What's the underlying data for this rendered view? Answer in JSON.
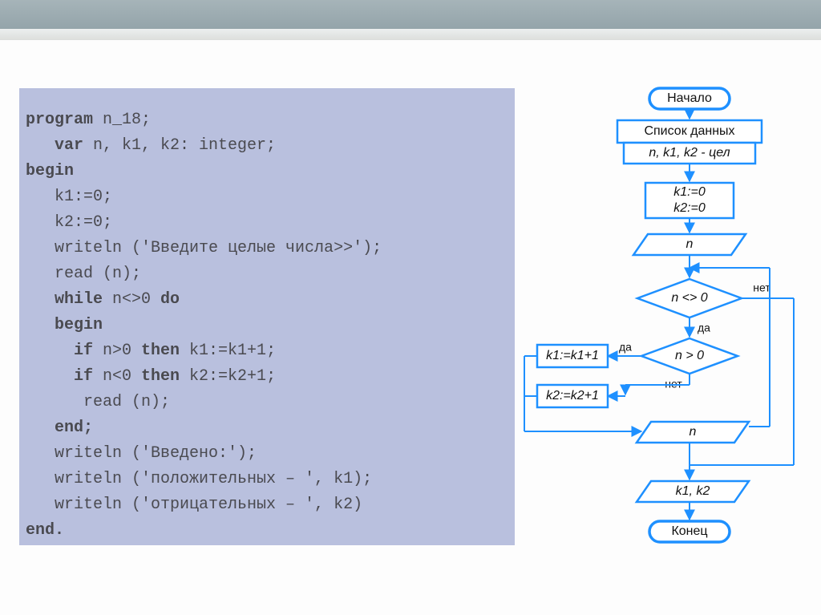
{
  "code": {
    "l01a": "program",
    "l01b": " n_18;",
    "l02a": "   var",
    "l02b": " n, k1, k2: integer;",
    "l03a": "begin",
    "l04": "   k1:=0;",
    "l05": "   k2:=0;",
    "l06": "   writeln ('Введите целые числа>>');",
    "l07": "   read (n);",
    "l08a": "   while ",
    "l08b": "n<>0 ",
    "l08c": "do",
    "l09a": "   begin",
    "l10a": "     if ",
    "l10b": "n>0 ",
    "l10c": "then ",
    "l10d": "k1:=k1+1;",
    "l11a": "     if ",
    "l11b": "n<0 ",
    "l11c": "then ",
    "l11d": "k2:=k2+1;",
    "l12": "      read (n);",
    "l13a": "   end;",
    "l14": "   writeln ('Введено:');",
    "l15": "   writeln ('положительных – ', k1);",
    "l16": "   writeln ('отрицательных – ', k2)",
    "l17a": "end."
  },
  "flow": {
    "start": "Начало",
    "datalist": "Список данных",
    "vars": "n, k1, k2 - цел",
    "init1": "k1:=0",
    "init2": "k2:=0",
    "in_n1": "n",
    "cond1": "n <> 0",
    "cond2": "n > 0",
    "assign1": "k1:=k1+1",
    "assign2": "k2:=k2+1",
    "in_n2": "n",
    "out": "k1, k2",
    "end": "Конец",
    "yes": "да",
    "no": "нет"
  },
  "chart_data": {
    "type": "flowchart",
    "nodes": [
      {
        "id": "start",
        "kind": "terminator",
        "text": "Начало"
      },
      {
        "id": "datalist",
        "kind": "process",
        "text": "Список данных"
      },
      {
        "id": "vars",
        "kind": "process",
        "text": "n, k1, k2 - цел"
      },
      {
        "id": "init",
        "kind": "process",
        "text": "k1:=0; k2:=0"
      },
      {
        "id": "in_n1",
        "kind": "io",
        "text": "n"
      },
      {
        "id": "cond1",
        "kind": "decision",
        "text": "n <> 0"
      },
      {
        "id": "cond2",
        "kind": "decision",
        "text": "n > 0"
      },
      {
        "id": "assign1",
        "kind": "process",
        "text": "k1:=k1+1"
      },
      {
        "id": "assign2",
        "kind": "process",
        "text": "k2:=k2+1"
      },
      {
        "id": "in_n2",
        "kind": "io",
        "text": "n"
      },
      {
        "id": "out",
        "kind": "io",
        "text": "k1, k2"
      },
      {
        "id": "end",
        "kind": "terminator",
        "text": "Конец"
      }
    ],
    "edges": [
      {
        "from": "start",
        "to": "datalist"
      },
      {
        "from": "datalist",
        "to": "vars"
      },
      {
        "from": "vars",
        "to": "init"
      },
      {
        "from": "init",
        "to": "in_n1"
      },
      {
        "from": "in_n1",
        "to": "cond1"
      },
      {
        "from": "cond1",
        "to": "cond2",
        "label": "да"
      },
      {
        "from": "cond1",
        "to": "out",
        "label": "нет"
      },
      {
        "from": "cond2",
        "to": "assign1",
        "label": "да"
      },
      {
        "from": "cond2",
        "to": "assign2",
        "label": "нет"
      },
      {
        "from": "assign1",
        "to": "in_n2"
      },
      {
        "from": "assign2",
        "to": "in_n2"
      },
      {
        "from": "in_n2",
        "to": "cond1"
      },
      {
        "from": "out",
        "to": "end"
      }
    ]
  }
}
